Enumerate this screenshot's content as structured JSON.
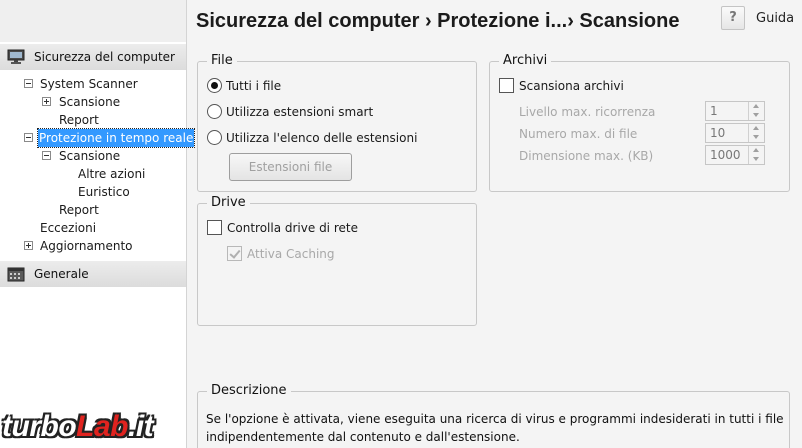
{
  "header": {
    "title": "Sicurezza del computer › Protezione i...› Scansione",
    "help_icon": "?",
    "help_label": "Guida"
  },
  "sidebar": {
    "section_computer": {
      "label": "Sicurezza del computer",
      "icon": "monitor-icon"
    },
    "tree": {
      "system_scanner": "System Scanner",
      "scansione_1": "Scansione",
      "report_1": "Report",
      "protezione": "Protezione in tempo reale",
      "scansione_2": "Scansione",
      "altre_azioni": "Altre azioni",
      "euristico": "Euristico",
      "report_2": "Report",
      "eccezioni": "Eccezioni",
      "aggiornamento": "Aggiornamento"
    },
    "section_generale": {
      "label": "Generale",
      "icon": "calendar-icon"
    }
  },
  "file_group": {
    "title": "File",
    "options": [
      "Tutti i file",
      "Utilizza estensioni smart",
      "Utilizza l'elenco delle estensioni"
    ],
    "selected_index": 0,
    "button": "Estensioni file"
  },
  "archivi_group": {
    "title": "Archivi",
    "checkbox": "Scansiona archivi",
    "checked": false,
    "fields": [
      {
        "label": "Livello max. ricorrenza",
        "value": "1"
      },
      {
        "label": "Numero max. di file",
        "value": "10"
      },
      {
        "label": "Dimensione max. (KB)",
        "value": "1000"
      }
    ]
  },
  "drive_group": {
    "title": "Drive",
    "checkbox": "Controlla drive di rete",
    "checked": false,
    "sub_checkbox": "Attiva Caching",
    "sub_checked": true
  },
  "descrizione": {
    "title": "Descrizione",
    "text": "Se l'opzione è attivata, viene eseguita una ricerca di virus e programmi indesiderati in tutti i file indipendentemente dal contenuto e dall'estensione."
  },
  "watermark": {
    "part1": "turbo",
    "part2": "Lab",
    "part3": ".it"
  },
  "colors": {
    "selection": "#3399ff",
    "watermark_red": "#e0231f"
  }
}
